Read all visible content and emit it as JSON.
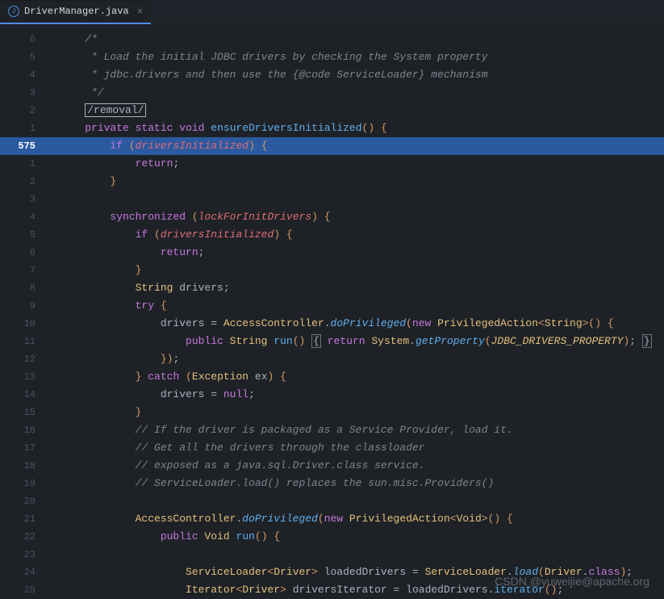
{
  "tab": {
    "filename": "DriverManager.java"
  },
  "current_line_number": "575",
  "gutter_rel": [
    "6",
    "5",
    "4",
    "3",
    "2",
    "1",
    "575",
    "1",
    "2",
    "3",
    "4",
    "5",
    "6",
    "7",
    "8",
    "9",
    "10",
    "11",
    "12",
    "13",
    "14",
    "15",
    "16",
    "17",
    "18",
    "19",
    "20",
    "21",
    "22",
    "23",
    "24",
    "25"
  ],
  "code": {
    "l0_comment": "/*",
    "l1_comment": " * Load the initial JDBC drivers by checking the System property",
    "l2_comment": " * jdbc.drivers and then use the {@code ServiceLoader} mechanism",
    "l3_comment": " */",
    "l4_boxed": "/removal/",
    "l5_kw1": "private",
    "l5_kw2": "static",
    "l5_kw3": "void",
    "l5_method": "ensureDriversInitialized",
    "l6_kw": "if",
    "l6_field": "driversInitialized",
    "l7_kw": "return",
    "l10_kw": "synchronized",
    "l10_field": "lockForInitDrivers",
    "l11_kw": "if",
    "l11_field": "driversInitialized",
    "l12_kw": "return",
    "l14_type": "String",
    "l14_var": "drivers",
    "l15_kw": "try",
    "l16_var": "drivers",
    "l16_class": "AccessController",
    "l16_method": "doPrivileged",
    "l16_kw": "new",
    "l16_class2": "PrivilegedAction",
    "l16_type": "String",
    "l17_kw1": "public",
    "l17_type": "String",
    "l17_method": "run",
    "l17_kw2": "return",
    "l17_class": "System",
    "l17_method2": "getProperty",
    "l17_const": "JDBC_DRIVERS_PROPERTY",
    "l19_kw": "catch",
    "l19_class": "Exception",
    "l19_var": "ex",
    "l20_var": "drivers",
    "l20_kw": "null",
    "l22_comment": "// If the driver is packaged as a Service Provider, load it.",
    "l23_comment": "// Get all the drivers through the classloader",
    "l24_comment": "// exposed as a java.sql.Driver.class service.",
    "l25_comment": "// ServiceLoader.load() replaces the sun.misc.Providers()",
    "l27_class": "AccessController",
    "l27_method": "doPrivileged",
    "l27_kw": "new",
    "l27_class2": "PrivilegedAction",
    "l27_type": "Void",
    "l28_kw": "public",
    "l28_type": "Void",
    "l28_method": "run",
    "l30_class": "ServiceLoader",
    "l30_type": "Driver",
    "l30_var": "loadedDrivers",
    "l30_class2": "ServiceLoader",
    "l30_method": "load",
    "l30_class3": "Driver",
    "l30_kw": "class",
    "l31_class": "Iterator",
    "l31_type": "Driver",
    "l31_var": "driversIterator",
    "l31_var2": "loadedDrivers",
    "l31_method": "iterator"
  },
  "watermark": "CSDN @yuweijie@apache.org"
}
